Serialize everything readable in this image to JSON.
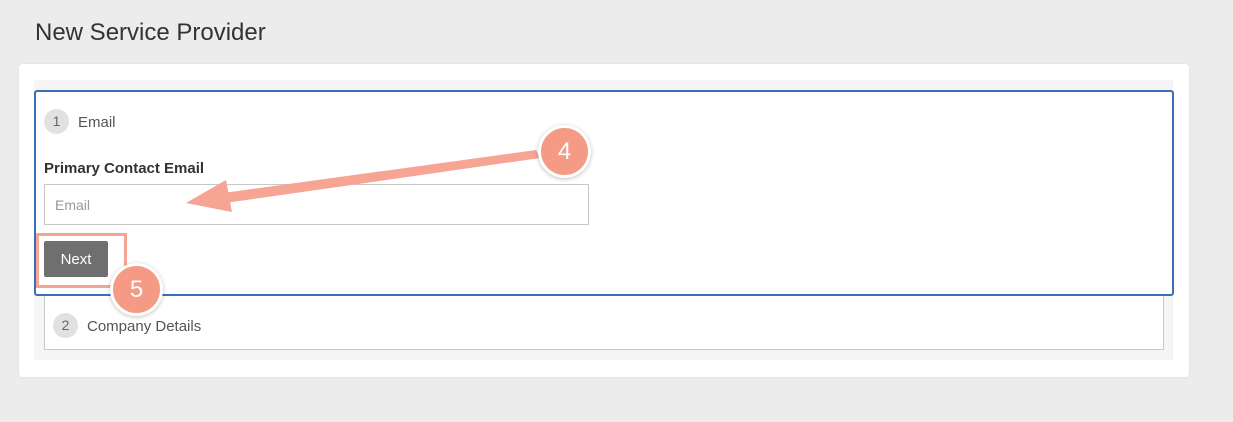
{
  "page": {
    "title": "New Service Provider"
  },
  "steps": [
    {
      "number": "1",
      "label": "Email"
    },
    {
      "number": "2",
      "label": "Company Details"
    }
  ],
  "form": {
    "email_label": "Primary Contact Email",
    "email_placeholder": "Email",
    "email_value": "",
    "next_label": "Next"
  },
  "annotations": {
    "marker_4": "4",
    "marker_5": "5",
    "color": "#f59a85"
  }
}
